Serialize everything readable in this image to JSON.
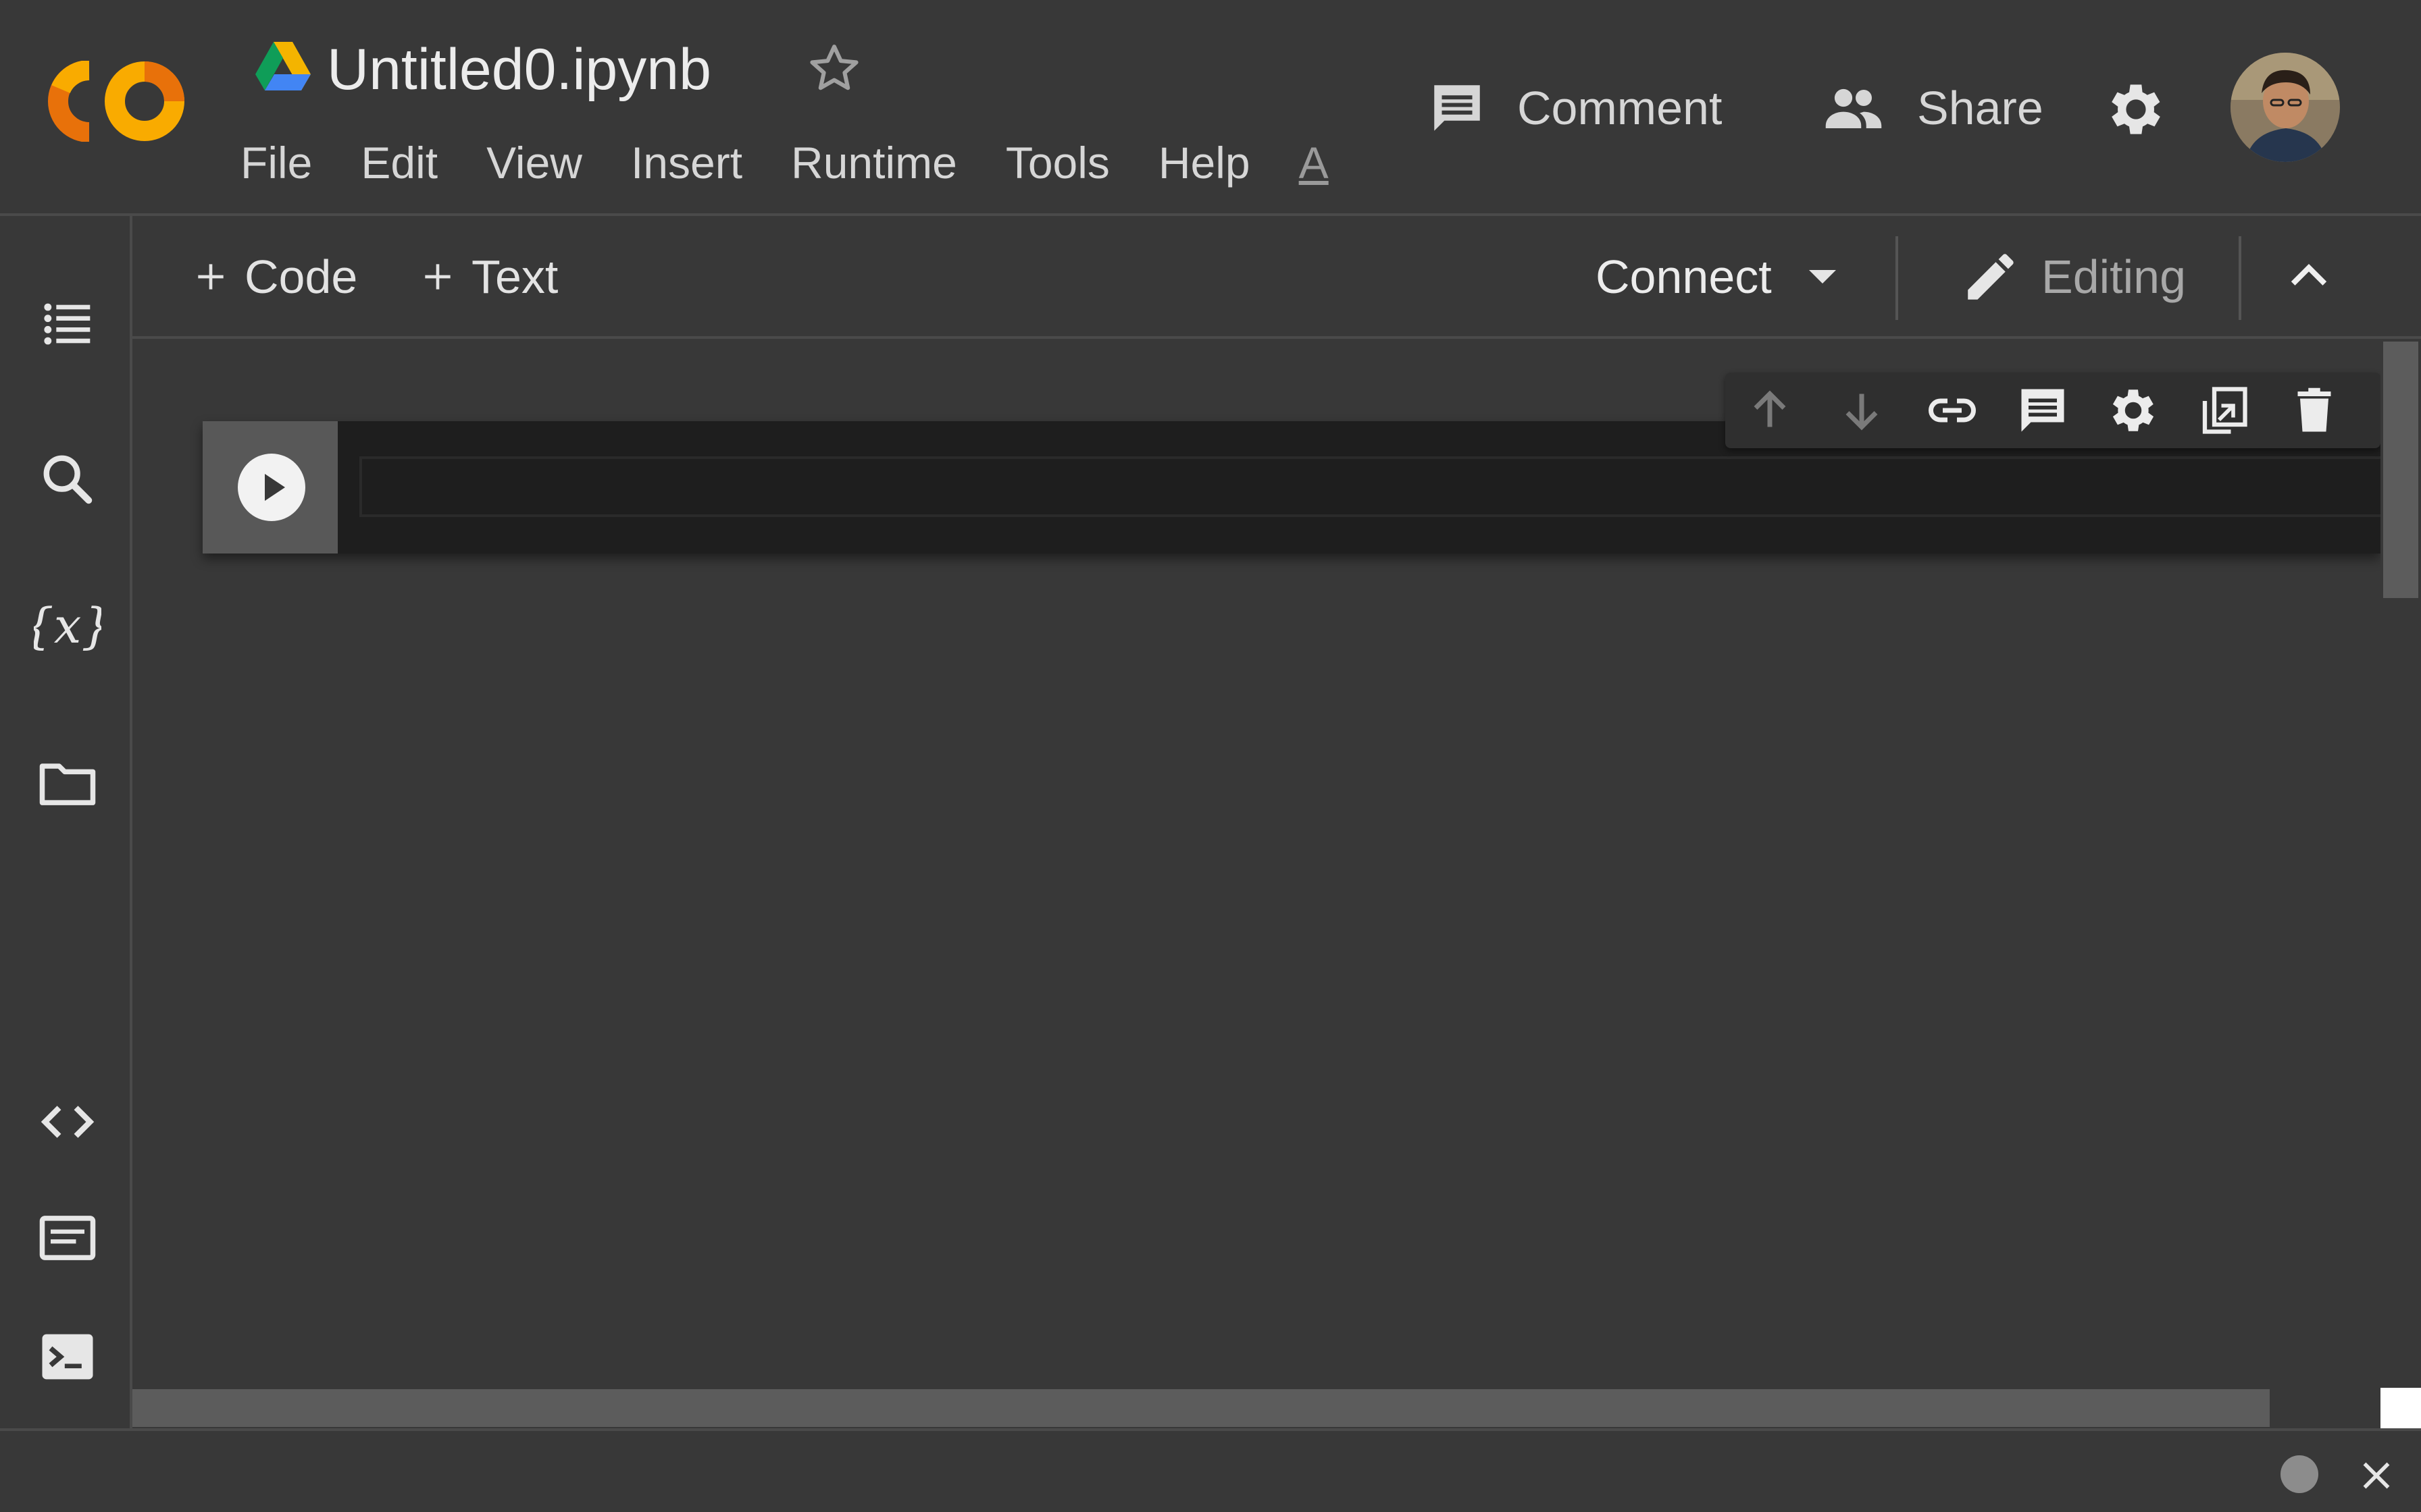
{
  "app": {
    "logo_text": "CO",
    "document_title": "Untitled0.ipynb"
  },
  "menu": [
    "File",
    "Edit",
    "View",
    "Insert",
    "Runtime",
    "Tools",
    "Help"
  ],
  "accessibility_label": "A",
  "header_actions": {
    "comment_label": "Comment",
    "share_label": "Share"
  },
  "toolbar": {
    "add_code_label": "Code",
    "add_text_label": "Text",
    "connect_label": "Connect",
    "editing_label": "Editing"
  },
  "sidebar_icons": [
    "table-of-contents-icon",
    "search-icon",
    "variables-icon",
    "files-icon",
    "code-snippets-icon",
    "command-palette-icon",
    "terminal-icon"
  ],
  "cell_toolbar_icons": [
    "move-up-icon",
    "move-down-icon",
    "link-icon",
    "comment-icon",
    "settings-icon",
    "mirror-cell-icon",
    "delete-icon"
  ],
  "cell": {
    "type": "code",
    "content": ""
  },
  "colors": {
    "background": "#383838",
    "cell_background": "#1e1e1e",
    "logo_orange": "#f9ab00",
    "logo_dark_orange": "#e8710a",
    "drive_green": "#0f9d58",
    "drive_yellow": "#f4b400",
    "drive_blue": "#4285f4"
  }
}
